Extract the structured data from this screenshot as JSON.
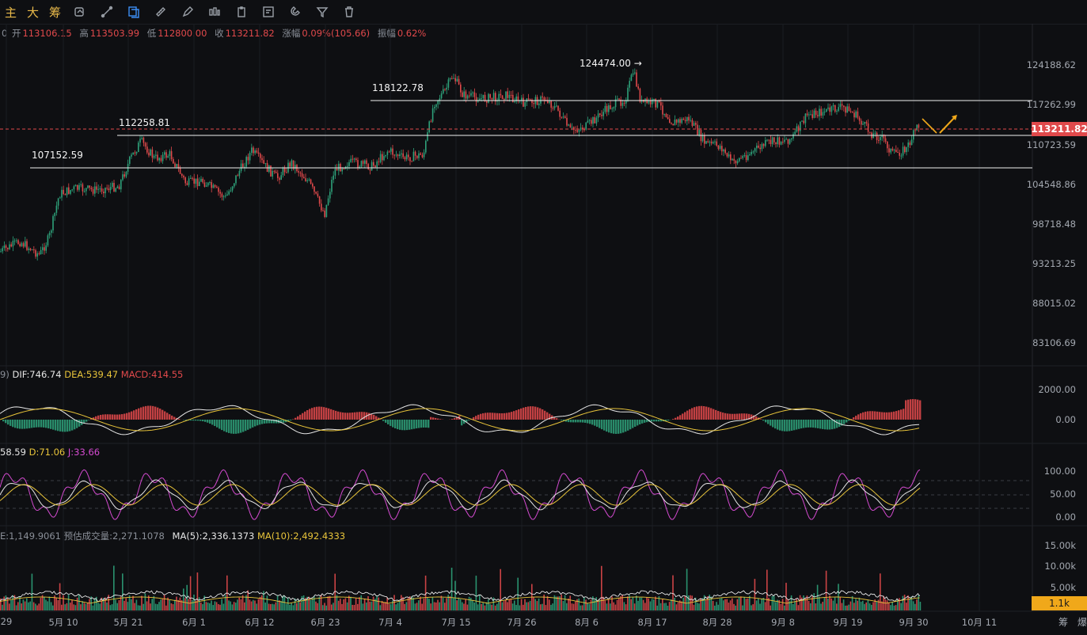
{
  "toolbar": {
    "main_label": "主",
    "big_label": "大",
    "chip_label": "筹",
    "icons": [
      "candle-reset-icon",
      "draw-line-icon",
      "selection-icon",
      "ruler-icon",
      "pen-icon",
      "candles-icon",
      "clipboard-icon",
      "note-icon",
      "magnet-icon",
      "filter-icon",
      "trash-icon"
    ]
  },
  "ohlc": {
    "prefix": "0",
    "open_label": "开",
    "open": "113106.15",
    "high_label": "高",
    "high": "113503.99",
    "low_label": "低",
    "low": "112800.00",
    "close_label": "收",
    "close": "113211.82",
    "change_label": "涨幅",
    "change": "0.09%(105.66)",
    "amplitude_label": "振幅",
    "amplitude": "0.62%"
  },
  "price_axis": [
    "124188.62",
    "117262.99",
    "110723.59",
    "104548.86",
    "98718.48",
    "93213.25",
    "88015.02",
    "83106.69"
  ],
  "current_price": "113211.82",
  "levels": [
    {
      "label": "124474.00 →"
    },
    {
      "label": "118122.78"
    },
    {
      "label": "112258.81"
    },
    {
      "label": "107152.59"
    }
  ],
  "macd": {
    "prefix": "9)",
    "dif": "DIF:746.74",
    "dea": "DEA:539.47",
    "macd": "MACD:414.55",
    "axis": [
      "2000.00",
      "0.00"
    ]
  },
  "kdj": {
    "k": "58.59",
    "d": "D:71.06",
    "j": "J:33.66",
    "axis": [
      "100.00",
      "50.00",
      "0.00"
    ]
  },
  "volume": {
    "vol": "E:1,149.9061",
    "est": "预估成交量:2,271.1078",
    "ma5": "MA(5):2,336.1373",
    "ma10": "MA(10):2,492.4333",
    "axis": [
      "15.00k",
      "10.00k",
      "5.00k"
    ],
    "current": "1.1k"
  },
  "time_axis": [
    "29",
    "5月 10",
    "5月 21",
    "6月 1",
    "6月 12",
    "6月 23",
    "7月 4",
    "7月 15",
    "7月 26",
    "8月 6",
    "8月 17",
    "8月 28",
    "9月 8",
    "9月 19",
    "9月 30",
    "10月 11"
  ],
  "corner": {
    "a": "筹",
    "b": "爆"
  },
  "colors": {
    "up": "#2ea17a",
    "down": "#e0494b",
    "accent": "#e8b94a"
  }
}
